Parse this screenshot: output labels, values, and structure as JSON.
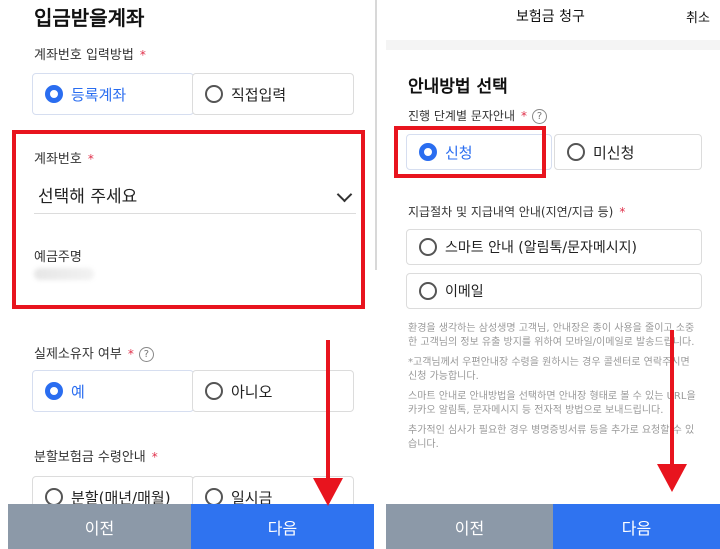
{
  "left": {
    "title": "입금받을계좌",
    "method_label": "계좌번호 입력방법",
    "required_mark": "*",
    "method_options": [
      "등록계좌",
      "직접입력"
    ],
    "account_label": "계좌번호",
    "account_select_placeholder": "선택해 주세요",
    "holder_label": "예금주명",
    "owner_label": "실제소유자 여부",
    "help_symbol": "?",
    "owner_options": [
      "예",
      "아니오"
    ],
    "split_label": "분할보험금 수령안내",
    "split_options": [
      "분할(매년/매월)",
      "일시금"
    ],
    "prev_button": "이전",
    "next_button": "다음"
  },
  "right": {
    "header_title": "보험금 청구",
    "cancel": "취소",
    "section_title": "안내방법 선택",
    "progress_label": "진행 단계별 문자안내",
    "required_mark": "*",
    "help_symbol": "?",
    "progress_options": [
      "신청",
      "미신청"
    ],
    "payment_label": "지급절차 및 지급내역 안내(지연/지급 등)",
    "payment_options": [
      "스마트 안내 (알림톡/문자메시지)",
      "이메일"
    ],
    "notice": [
      "환경을 생각하는 삼성생명 고객님, 안내장은 종이 사용을 줄이고 소중한 고객님의 정보 유출 방지를 위하여 모바일/이메일로 발송드립니다.",
      "*고객님께서 우편안내장 수령을 원하시는 경우 콜센터로 연락주시면 신청 가능합니다.",
      "스마트 안내로 안내방법을 선택하면 안내장 형태로 볼 수 있는 URL을 카카오 알림톡, 문자메시지 등 전자적 방법으로 보내드립니다.",
      "추가적인 심사가 필요한 경우 병명증빙서류 등을 추가로 요청할 수 있습니다."
    ],
    "prev_button": "이전",
    "next_button": "다음"
  },
  "colors": {
    "accent": "#2f73f0",
    "highlight_box": "#e8141e",
    "required": "#e0304a",
    "prev_button_bg": "#8c99a8"
  }
}
